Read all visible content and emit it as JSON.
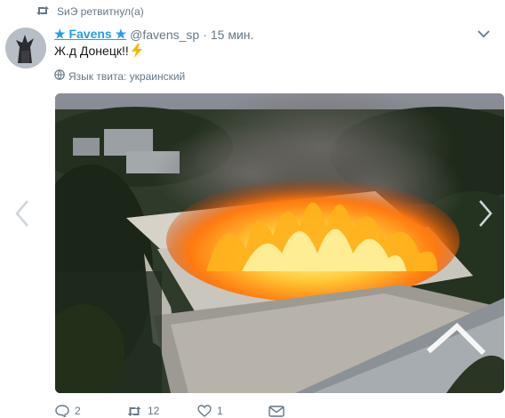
{
  "retweet": {
    "text": "SиЭ ретвитнул(а)",
    "icon": "retweet-icon"
  },
  "tweet": {
    "author_name": "★ Favens ★",
    "handle": "@favens_sp",
    "separator": "·",
    "time": "15 мин.",
    "text": "Ж.д Донецк!!",
    "emoji": "high-voltage-icon",
    "language_note": "Язык твита: украинский",
    "media_description_icon": "photo-burning-building"
  },
  "actions": {
    "replies": "2",
    "retweets": "12",
    "likes": "1"
  },
  "colors": {
    "link": "#1da1f2",
    "secondary": "#657786",
    "text": "#14171a"
  }
}
